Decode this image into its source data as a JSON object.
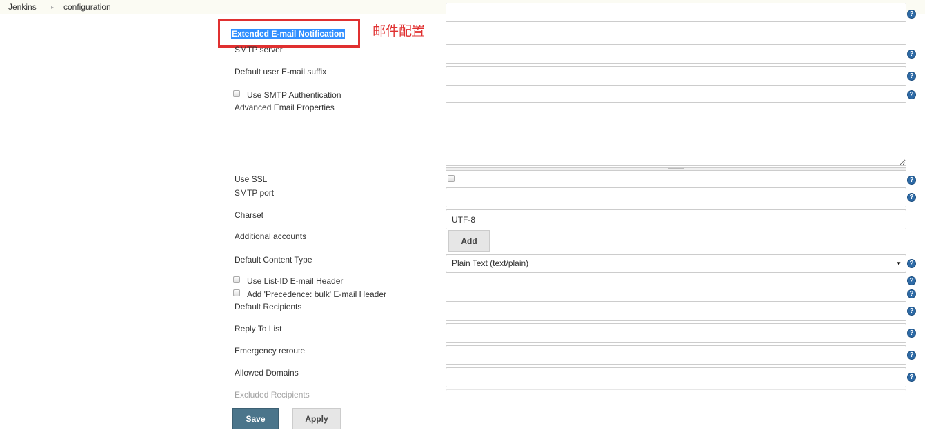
{
  "breadcrumb": {
    "items": [
      "Jenkins",
      "configuration"
    ]
  },
  "section": {
    "title": "Extended E-mail Notification",
    "annotation": "邮件配置",
    "annotation_color": "#e03030",
    "highlight_color": "#3390ff"
  },
  "fields": {
    "smtp_server": {
      "label": "SMTP server",
      "value": ""
    },
    "default_suffix": {
      "label": "Default user E-mail suffix",
      "value": ""
    },
    "use_smtp_auth": {
      "label": "Use SMTP Authentication",
      "checked": false
    },
    "advanced_props": {
      "label": "Advanced Email Properties",
      "value": ""
    },
    "use_ssl": {
      "label": "Use SSL",
      "checked": false
    },
    "smtp_port": {
      "label": "SMTP port",
      "value": ""
    },
    "charset": {
      "label": "Charset",
      "value": "UTF-8"
    },
    "additional_accounts": {
      "label": "Additional accounts",
      "button": "Add"
    },
    "content_type": {
      "label": "Default Content Type",
      "value": "Plain Text (text/plain)"
    },
    "list_id": {
      "label": "Use List-ID E-mail Header",
      "checked": false
    },
    "precedence": {
      "label": "Add 'Precedence: bulk' E-mail Header",
      "checked": false
    },
    "default_recipients": {
      "label": "Default Recipients",
      "value": ""
    },
    "reply_to": {
      "label": "Reply To List",
      "value": ""
    },
    "emergency": {
      "label": "Emergency reroute",
      "value": ""
    },
    "allowed_domains": {
      "label": "Allowed Domains",
      "value": ""
    },
    "excluded": {
      "label": "Excluded Recipients",
      "value": ""
    }
  },
  "help_icon": "?",
  "actions": {
    "save": "Save",
    "apply": "Apply",
    "save_color": "#4b758b"
  }
}
